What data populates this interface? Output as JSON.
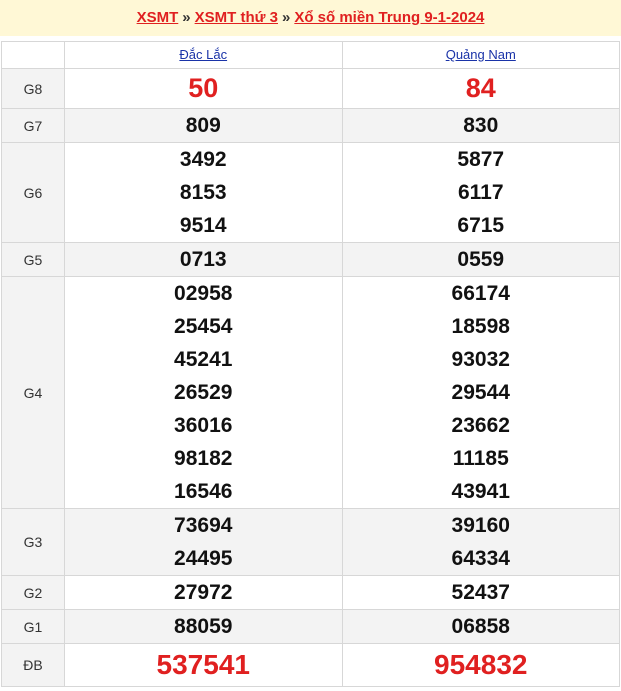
{
  "breadcrumb": {
    "items": [
      "XSMT",
      "XSMT thứ 3",
      "Xổ số miền Trung 9-1-2024"
    ],
    "separator": "»"
  },
  "table": {
    "columns": [
      "Đắc Lắc",
      "Quảng Nam"
    ],
    "rows": [
      {
        "label": "G8",
        "style": "big",
        "values": [
          [
            "50"
          ],
          [
            "84"
          ]
        ]
      },
      {
        "label": "G7",
        "style": "n",
        "values": [
          [
            "809"
          ],
          [
            "830"
          ]
        ]
      },
      {
        "label": "G6",
        "style": "n",
        "values": [
          [
            "3492",
            "8153",
            "9514"
          ],
          [
            "5877",
            "6117",
            "6715"
          ]
        ]
      },
      {
        "label": "G5",
        "style": "n",
        "values": [
          [
            "0713"
          ],
          [
            "0559"
          ]
        ]
      },
      {
        "label": "G4",
        "style": "n",
        "values": [
          [
            "02958",
            "25454",
            "45241",
            "26529",
            "36016",
            "98182",
            "16546"
          ],
          [
            "66174",
            "18598",
            "93032",
            "29544",
            "23662",
            "11185",
            "43941"
          ]
        ]
      },
      {
        "label": "G3",
        "style": "n",
        "values": [
          [
            "73694",
            "24495"
          ],
          [
            "39160",
            "64334"
          ]
        ]
      },
      {
        "label": "G2",
        "style": "n",
        "values": [
          [
            "27972"
          ],
          [
            "52437"
          ]
        ]
      },
      {
        "label": "G1",
        "style": "n",
        "values": [
          [
            "88059"
          ],
          [
            "06858"
          ]
        ]
      },
      {
        "label": "ĐB",
        "style": "db",
        "values": [
          [
            "537541"
          ],
          [
            "954832"
          ]
        ]
      }
    ]
  },
  "colors": {
    "accent": "#e02020",
    "link": "#1a33a8",
    "header_bg": "#fff8d6",
    "alt_row": "#f3f3f3"
  }
}
